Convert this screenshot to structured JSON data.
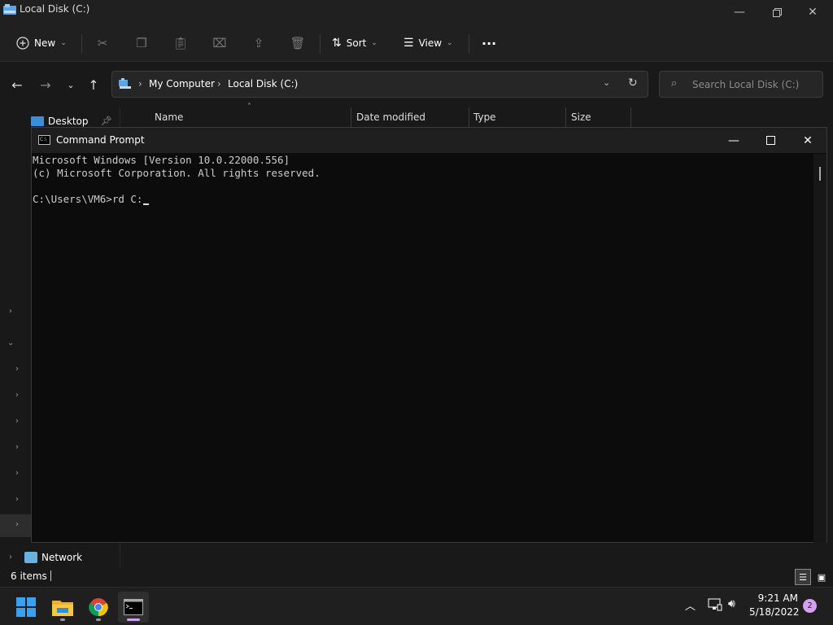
{
  "explorer": {
    "title": "Local Disk (C:)",
    "commands": {
      "new_label": "New",
      "sort_label": "Sort",
      "view_label": "View",
      "more_label": "···"
    },
    "address": {
      "crumbs": [
        "My Computer",
        "Local Disk (C:)"
      ]
    },
    "search": {
      "placeholder": "Search Local Disk (C:)"
    },
    "sidebar": {
      "items": [
        {
          "label": "Desktop"
        },
        {
          "label": "Network"
        }
      ]
    },
    "columns": [
      "Name",
      "Date modified",
      "Type",
      "Size"
    ],
    "status": {
      "items_count": "6 items"
    }
  },
  "cmd": {
    "title": "Command Prompt",
    "lines": [
      "Microsoft Windows [Version 10.0.22000.556]",
      "(c) Microsoft Corporation. All rights reserved.",
      "",
      "C:\\Users\\VM6>rd C:"
    ]
  },
  "taskbar": {
    "time": "9:21 AM",
    "date": "5/18/2022",
    "notification_count": "2"
  },
  "colors": {
    "accent": "#0078d4",
    "badge": "#d5a0f0",
    "console_bg": "#0c0c0c",
    "console_fg": "#cccccc"
  }
}
